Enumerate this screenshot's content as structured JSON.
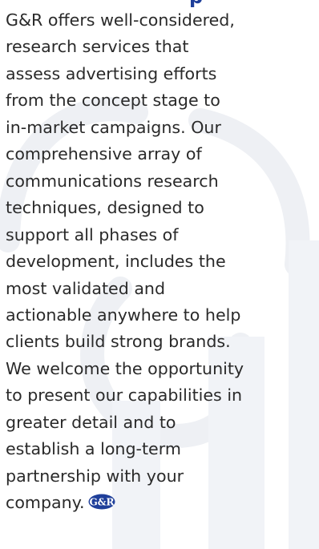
{
  "heading": {
    "partial_text": "p"
  },
  "body": {
    "lines": [
      "G&R offers well-considered,",
      "research services that",
      "assess advertising efforts",
      "from the concept stage to",
      "in-market campaigns. Our",
      "comprehensive array of",
      "communications research",
      "techniques, designed to",
      "support all phases of",
      "development, includes the",
      "most validated and",
      "actionable anywhere to help",
      "clients build strong brands.",
      "We welcome the opportunity",
      "to present our capabilities in",
      "greater detail and to",
      "establish a long-term",
      "partnership with your",
      "company."
    ]
  },
  "logo": {
    "text": "G&R",
    "fill_color": "#1f3f9a",
    "text_color": "#ffffff"
  },
  "colors": {
    "body_text": "#2a2a2a",
    "heading": "#1f3f9a",
    "watermark": "#eef0f4",
    "background": "#ffffff"
  }
}
